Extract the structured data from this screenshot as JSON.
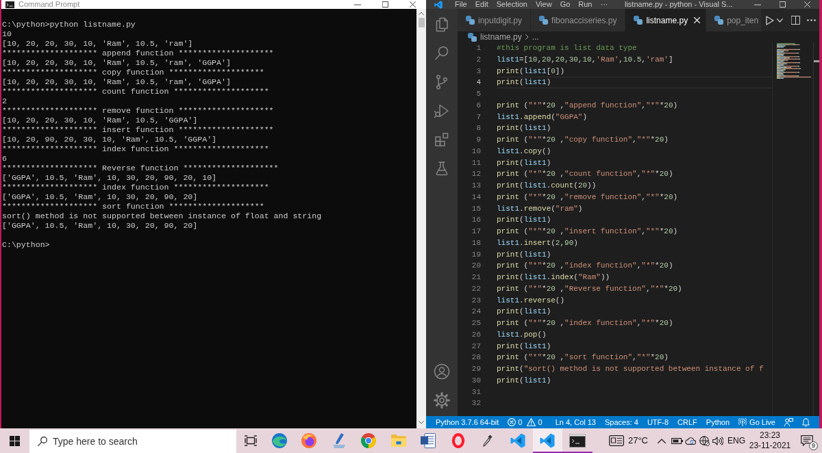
{
  "command_prompt": {
    "title": "Command Prompt",
    "lines": [
      "C:\\python>python listname.py",
      "10",
      "[10, 20, 20, 30, 10, 'Ram', 10.5, 'ram']",
      "******************** append function ********************",
      "[10, 20, 20, 30, 10, 'Ram', 10.5, 'ram', 'GGPA']",
      "******************** copy function ********************",
      "[10, 20, 20, 30, 10, 'Ram', 10.5, 'ram', 'GGPA']",
      "******************** count function ********************",
      "2",
      "******************** remove function ********************",
      "[10, 20, 20, 30, 10, 'Ram', 10.5, 'GGPA']",
      "******************** insert function ********************",
      "[10, 20, 90, 20, 30, 10, 'Ram', 10.5, 'GGPA']",
      "******************** index function ********************",
      "6",
      "******************** Reverse function ********************",
      "['GGPA', 10.5, 'Ram', 10, 30, 20, 90, 20, 10]",
      "******************** index function ********************",
      "['GGPA', 10.5, 'Ram', 10, 30, 20, 90, 20]",
      "******************** sort function ********************",
      "sort() method is not supported between instance of float and string",
      "['GGPA', 10.5, 'Ram', 10, 30, 20, 90, 20]"
    ],
    "prompt": "C:\\python>"
  },
  "vscode": {
    "menu": [
      "File",
      "Edit",
      "Selection",
      "View",
      "Go",
      "Run",
      "···"
    ],
    "title": "listname.py - python - Visual S...",
    "tabs": [
      {
        "label": "inputdigit.py",
        "selected": false
      },
      {
        "label": "fibonacciseries.py",
        "selected": false
      },
      {
        "label": "listname.py",
        "selected": true
      },
      {
        "label": "pop_iten",
        "selected": false
      }
    ],
    "breadcrumb": [
      "listname.py",
      "..."
    ],
    "lines": [
      {
        "number": "1",
        "code": "#this program is list data type",
        "active": false
      },
      {
        "number": "2",
        "code": "list1=[10,20,20,30,10,'Ram',10.5,'ram']",
        "active": false
      },
      {
        "number": "3",
        "code": "print(list1[0])",
        "active": false
      },
      {
        "number": "4",
        "code": "print(list1)",
        "active": true
      },
      {
        "number": "5",
        "active": false
      },
      {
        "number": "6",
        "code": "print (\"*\"*20 ,\"append function\",\"*\"*20)",
        "active": false
      },
      {
        "number": "7",
        "code": "list1.append(\"GGPA\")",
        "active": false
      },
      {
        "number": "8",
        "code": "print(list1)",
        "active": false
      },
      {
        "number": "9",
        "code": "print (\"*\"*20 ,\"copy function\",\"*\"*20)",
        "active": false
      },
      {
        "number": "10",
        "code": "list1.copy()",
        "active": false
      },
      {
        "number": "11",
        "code": "print(list1)",
        "active": false
      },
      {
        "number": "12",
        "code": "print (\"*\"*20 ,\"count function\",\"*\"*20)",
        "active": false
      },
      {
        "number": "13",
        "code": "print(list1.count(20))",
        "active": false
      },
      {
        "number": "14",
        "code": "print (\"*\"*20 ,\"remove function\",\"*\"*20)",
        "active": false
      },
      {
        "number": "15",
        "code": "list1.remove(\"ram\")",
        "active": false
      },
      {
        "number": "16",
        "code": "print(list1)",
        "active": false
      },
      {
        "number": "17",
        "code": "print (\"*\"*20 ,\"insert function\",\"*\"*20)",
        "active": false
      },
      {
        "number": "18",
        "code": "list1.insert(2,90)",
        "active": false
      },
      {
        "number": "19",
        "code": "print(list1)",
        "active": false
      },
      {
        "number": "20",
        "code": "print (\"*\"*20 ,\"index function\",\"*\"*20)",
        "active": false
      },
      {
        "number": "21",
        "code": "print(list1.index(\"Ram\"))",
        "active": false
      },
      {
        "number": "22",
        "code": "print (\"*\"*20 ,\"Reverse function\",\"*\"*20)",
        "active": false
      },
      {
        "number": "23",
        "code": "list1.reverse()",
        "active": false
      },
      {
        "number": "24",
        "code": "print(list1)",
        "active": false
      },
      {
        "number": "25",
        "code": "print (\"*\"*20 ,\"index function\",\"*\"*20)",
        "active": false
      },
      {
        "number": "26",
        "code": "list1.pop()",
        "active": false
      },
      {
        "number": "27",
        "code": "print(list1)",
        "active": false
      },
      {
        "number": "28",
        "code": "print (\"*\"*20 ,\"sort function\",\"*\"*20)",
        "active": false
      },
      {
        "number": "29",
        "code": "print(\"sort() method is not supported between instance of f",
        "active": false
      },
      {
        "number": "30",
        "code": "print(list1)",
        "active": false
      },
      {
        "number": "31",
        "active": false
      },
      {
        "number": "32",
        "active": false
      }
    ],
    "status_bar": {
      "interpreter": "Python 3.7.6 64-bit",
      "errors": "0",
      "warnings": "0",
      "cursor": "Ln 4, Col 13",
      "indentation": "Spaces: 4",
      "encoding": "UTF-8",
      "line_endings": "CRLF",
      "language": "Python",
      "live_server": "Go Live"
    }
  },
  "taskbar": {
    "search": {
      "placeholder": "Type here to search"
    },
    "apps": [
      {
        "kind": "swirl",
        "running": false,
        "selected": false
      },
      {
        "kind": "fox",
        "running": false,
        "selected": false
      },
      {
        "kind": "pen_tray",
        "running": false,
        "selected": false
      },
      {
        "kind": "segmented_circle",
        "running": false,
        "selected": false
      },
      {
        "kind": "folder",
        "running": false,
        "selected": false
      },
      {
        "kind": "document",
        "running": false,
        "selected": false
      },
      {
        "kind": "ring",
        "running": false,
        "selected": false
      },
      {
        "kind": "eyedropper",
        "running": false,
        "selected": false
      },
      {
        "kind": "ribbon",
        "running": false,
        "selected": false
      },
      {
        "kind": "ribbon",
        "running": true,
        "selected": true
      },
      {
        "kind": "terminal",
        "running": true,
        "selected": false
      }
    ],
    "temperature": "27°C",
    "language": "ENG",
    "time": "23:23",
    "date": "23-11-2021",
    "notifications": "9"
  }
}
